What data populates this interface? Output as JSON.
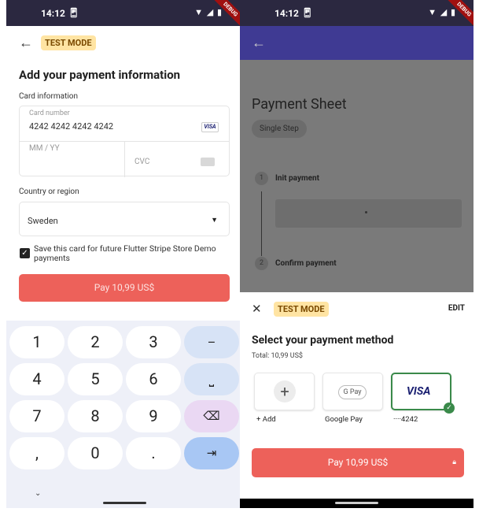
{
  "left": {
    "status": {
      "time": "14:12",
      "sim_icon": "sim-icon",
      "icons": "▼◢▮",
      "debug": "DEBUG"
    },
    "header": {
      "back_icon": "arrow-left-icon",
      "badge": "TEST MODE"
    },
    "title": "Add your payment information",
    "card_section": {
      "label": "Card information",
      "number_label": "Card number",
      "number_value": "4242 4242 4242 4242",
      "brand": "VISA",
      "expiry_placeholder": "MM / YY",
      "cvc_placeholder": "CVC"
    },
    "country_section": {
      "label": "Country or region",
      "value": "Sweden"
    },
    "save_card": {
      "checked": true,
      "label": "Save this card for future Flutter Stripe Store Demo payments"
    },
    "pay_button": "Pay 10,99 US$",
    "keypad": {
      "rows": [
        [
          "1",
          "2",
          "3",
          "–"
        ],
        [
          "4",
          "5",
          "6",
          "⎵"
        ],
        [
          "7",
          "8",
          "9",
          "⌫"
        ],
        [
          ",",
          "0",
          ".",
          "⇥"
        ]
      ],
      "collapse_icon": "chevron-down-icon"
    }
  },
  "right": {
    "status": {
      "time": "14:12",
      "debug": "DEBUG"
    },
    "appbar": {
      "back_icon": "arrow-left-icon"
    },
    "page": {
      "title": "Payment Sheet",
      "chip": "Single Step",
      "steps": [
        {
          "num": "1",
          "label": "Init payment"
        },
        {
          "num": "2",
          "label": "Confirm payment"
        }
      ],
      "step_box_text": "."
    },
    "sheet": {
      "close_icon": "close-icon",
      "badge": "TEST MODE",
      "edit": "EDIT",
      "title": "Select your payment method",
      "total": "Total: 10,99 US$",
      "methods": [
        {
          "label": "+ Add",
          "icon": "plus-icon",
          "glyph": "+"
        },
        {
          "label": "Google Pay",
          "icon": "gpay-icon",
          "glyph": "G Pay"
        },
        {
          "label": "····4242",
          "icon": "visa-icon",
          "glyph": "VISA",
          "selected": true
        }
      ],
      "pay_button": "Pay 10,99 US$",
      "lock_icon": "lock-icon"
    }
  },
  "colors": {
    "accent": "#ed615a",
    "appbar": "#3f3a93",
    "statusbar": "#2b2840",
    "badge_bg": "#ffe4a3",
    "selected": "#3a8a4a"
  }
}
